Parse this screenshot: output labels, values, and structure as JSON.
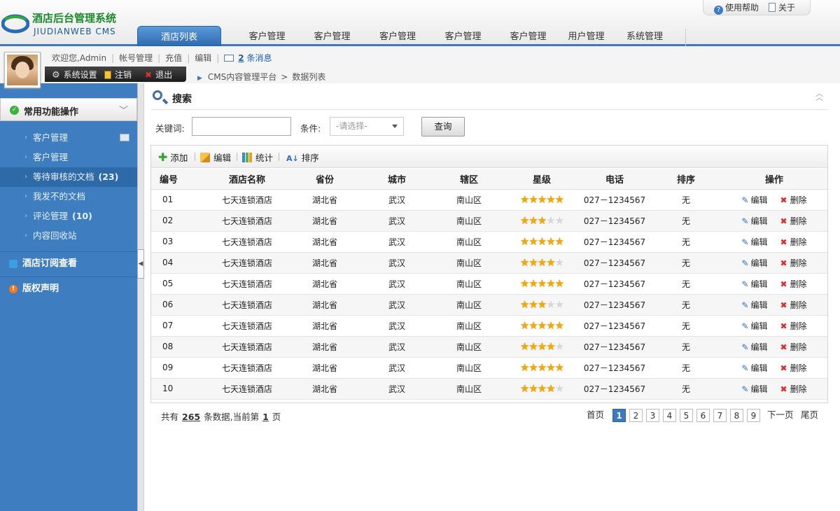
{
  "app": {
    "title_cn": "酒店后台管理系统",
    "title_en": "JIUDIANWEB CMS"
  },
  "top_links": {
    "help": "使用帮助",
    "about": "关于"
  },
  "tabs": [
    "酒店列表",
    "客户管理",
    "客户管理",
    "客户管理",
    "客户管理",
    "客户管理",
    "用户管理",
    "系统管理"
  ],
  "user": {
    "welcome": "欢迎您,Admin",
    "account": "帐号管理",
    "recharge": "充值",
    "edit": "编辑",
    "msg_count": "2",
    "msg_text": "条消息"
  },
  "sysbar": {
    "settings": "系统设置",
    "logout": "注销",
    "exit": "退出"
  },
  "breadcrumb": {
    "root": "CMS内容管理平台",
    "sep": ">",
    "current": "数据列表"
  },
  "sidebar": {
    "section1": "常用功能操作",
    "items": [
      {
        "label": "客户管理",
        "count": ""
      },
      {
        "label": "客户管理",
        "count": ""
      },
      {
        "label": "等待审核的文档",
        "count": "(23)"
      },
      {
        "label": "我发不的文档",
        "count": ""
      },
      {
        "label": "评论管理",
        "count": "(10)"
      },
      {
        "label": "内容回收站",
        "count": ""
      }
    ],
    "section2": "酒店订阅查看",
    "section3": "版权声明"
  },
  "search": {
    "title": "搜索",
    "keyword_label": "关键词:",
    "condition_label": "条件:",
    "select_value": "-请选择-",
    "query_button": "查询"
  },
  "toolbar": {
    "add": "添加",
    "edit": "编辑",
    "stats": "统计",
    "sort": "排序"
  },
  "table": {
    "headers": [
      "编号",
      "酒店名称",
      "省份",
      "城市",
      "辖区",
      "星级",
      "电话",
      "排序",
      "操作"
    ],
    "edit_label": "编辑",
    "delete_label": "删除",
    "rows": [
      {
        "id": "01",
        "name": "七天连锁酒店",
        "province": "湖北省",
        "city": "武汉",
        "district": "南山区",
        "stars": 5,
        "phone": "027－1234567",
        "sort": "无"
      },
      {
        "id": "02",
        "name": "七天连锁酒店",
        "province": "湖北省",
        "city": "武汉",
        "district": "南山区",
        "stars": 3,
        "phone": "027－1234567",
        "sort": "无"
      },
      {
        "id": "03",
        "name": "七天连锁酒店",
        "province": "湖北省",
        "city": "武汉",
        "district": "南山区",
        "stars": 5,
        "phone": "027－1234567",
        "sort": "无"
      },
      {
        "id": "04",
        "name": "七天连锁酒店",
        "province": "湖北省",
        "city": "武汉",
        "district": "南山区",
        "stars": 4,
        "phone": "027－1234567",
        "sort": "无"
      },
      {
        "id": "05",
        "name": "七天连锁酒店",
        "province": "湖北省",
        "city": "武汉",
        "district": "南山区",
        "stars": 5,
        "phone": "027－1234567",
        "sort": "无"
      },
      {
        "id": "06",
        "name": "七天连锁酒店",
        "province": "湖北省",
        "city": "武汉",
        "district": "南山区",
        "stars": 3,
        "phone": "027－1234567",
        "sort": "无"
      },
      {
        "id": "07",
        "name": "七天连锁酒店",
        "province": "湖北省",
        "city": "武汉",
        "district": "南山区",
        "stars": 5,
        "phone": "027－1234567",
        "sort": "无"
      },
      {
        "id": "08",
        "name": "七天连锁酒店",
        "province": "湖北省",
        "city": "武汉",
        "district": "南山区",
        "stars": 4,
        "phone": "027－1234567",
        "sort": "无"
      },
      {
        "id": "09",
        "name": "七天连锁酒店",
        "province": "湖北省",
        "city": "武汉",
        "district": "南山区",
        "stars": 5,
        "phone": "027－1234567",
        "sort": "无"
      },
      {
        "id": "10",
        "name": "七天连锁酒店",
        "province": "湖北省",
        "city": "武汉",
        "district": "南山区",
        "stars": 4,
        "phone": "027－1234567",
        "sort": "无"
      }
    ]
  },
  "footer": {
    "prefix": "共有",
    "total": "265",
    "mid": "条数据,当前第",
    "page": "1",
    "suffix": "页"
  },
  "pager": {
    "first": "首页",
    "pages": [
      "1",
      "2",
      "3",
      "4",
      "5",
      "6",
      "7",
      "8",
      "9"
    ],
    "current": "1",
    "next": "下一页",
    "last": "尾页"
  },
  "colors": {
    "accent": "#3b7ac0",
    "sidebar": "#3d7dc0",
    "star": "#f5a800"
  }
}
